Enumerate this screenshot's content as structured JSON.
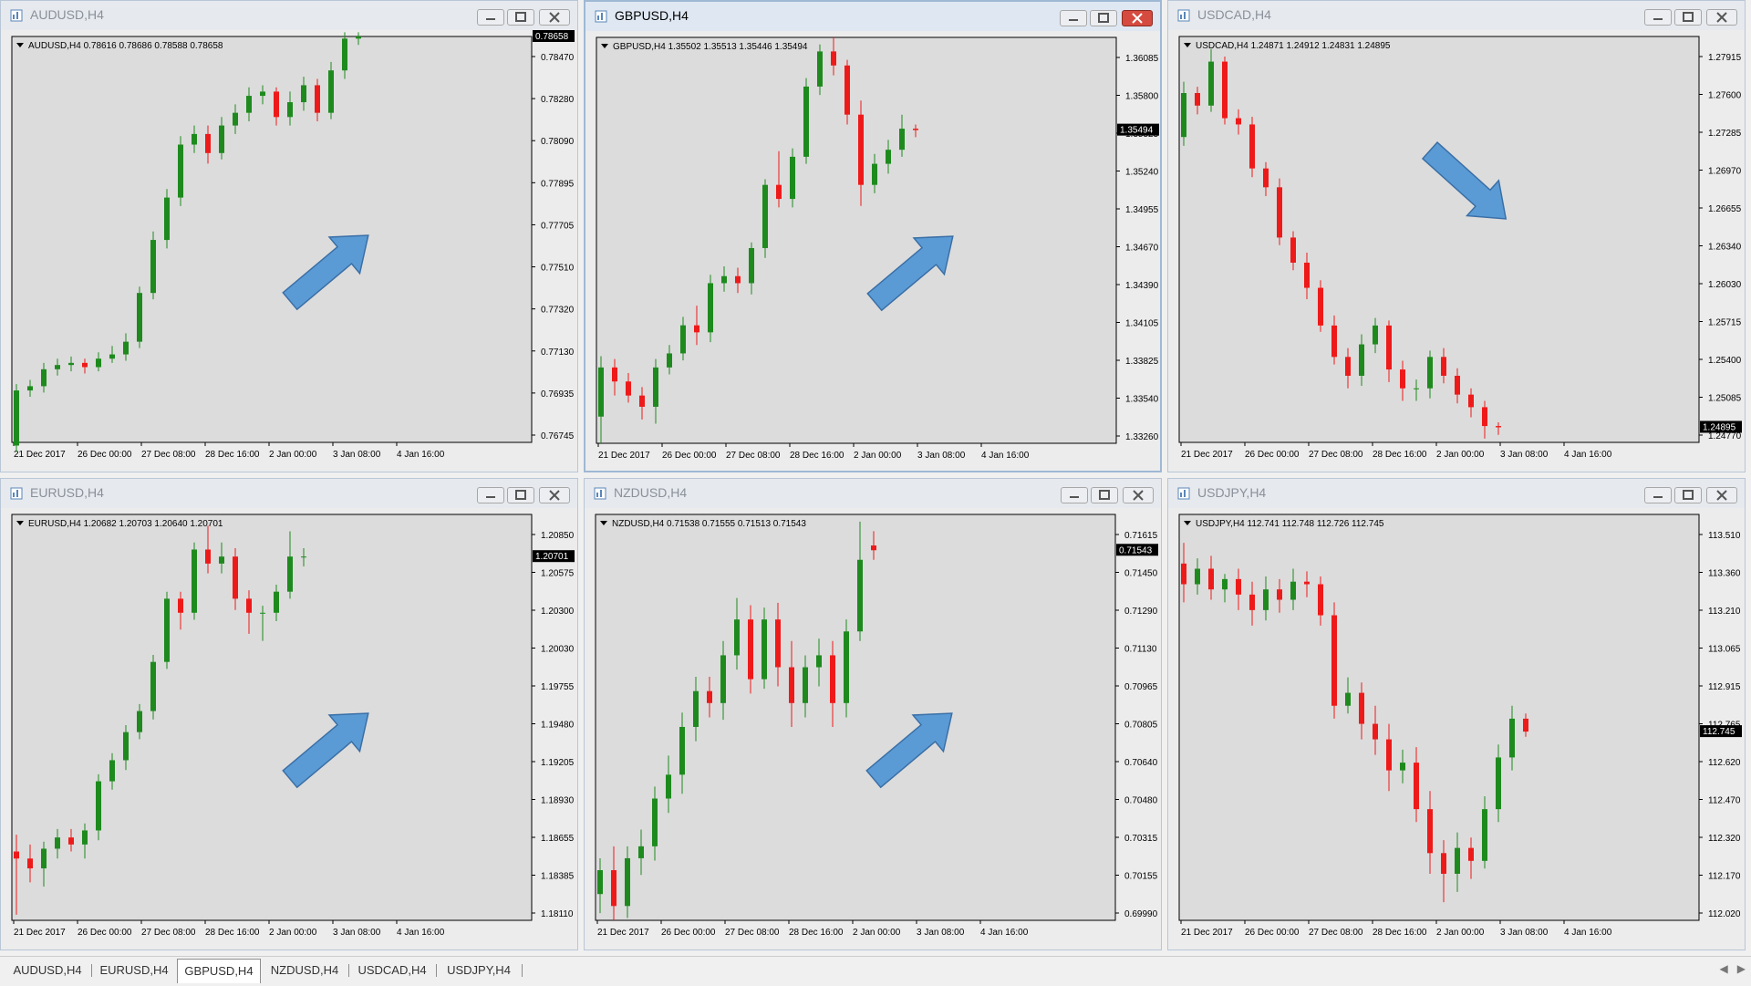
{
  "colors": {
    "bull": "#1e8a1e",
    "bear": "#ee1a1a",
    "wick": "#000000",
    "plot_bg": "#dcdcdc",
    "window_bg": "#ececec",
    "axis": "#000000",
    "arrow_fill": "#5b9bd5",
    "arrow_stroke": "#3a6fa6",
    "price_tag_bg": "#000000",
    "price_tag_fg": "#ffffff"
  },
  "x_tick_labels": [
    "21 Dec 2017",
    "26 Dec 00:00",
    "27 Dec 08:00",
    "28 Dec 16:00",
    "2 Jan 00:00",
    "3 Jan 08:00",
    "4 Jan 16:00"
  ],
  "windows": [
    {
      "title": "AUDUSD,H4",
      "active": false,
      "info": "AUDUSD,H4  0.78616 0.78686 0.78588 0.78658",
      "current_price": "0.78658",
      "y_ticks": [
        "0.78470",
        "0.78280",
        "0.78090",
        "0.77895",
        "0.77705",
        "0.77510",
        "0.77320",
        "0.77130",
        "0.76935",
        "0.76745"
      ],
      "arrow": "up",
      "chart_data": {
        "type": "candlestick",
        "ylim": [
          0.76745,
          0.7866
        ],
        "open": [
          0.7673,
          0.7699,
          0.7701,
          0.7709,
          0.7711,
          0.7712,
          0.771,
          0.7714,
          0.7716,
          0.7722,
          0.7745,
          0.777,
          0.779,
          0.7815,
          0.782,
          0.7811,
          0.7824,
          0.783,
          0.7838,
          0.784,
          0.7828,
          0.7835,
          0.7843,
          0.783,
          0.785,
          0.7865
        ],
        "close": [
          0.7699,
          0.7701,
          0.7709,
          0.7711,
          0.7712,
          0.771,
          0.7714,
          0.7716,
          0.7722,
          0.7745,
          0.777,
          0.779,
          0.7815,
          0.782,
          0.7811,
          0.7824,
          0.783,
          0.7838,
          0.784,
          0.7828,
          0.7835,
          0.7843,
          0.783,
          0.785,
          0.7865,
          0.7866
        ],
        "high": [
          0.7702,
          0.7704,
          0.7712,
          0.7714,
          0.7715,
          0.7714,
          0.7717,
          0.772,
          0.7726,
          0.7748,
          0.7774,
          0.7794,
          0.7819,
          0.7824,
          0.7824,
          0.7828,
          0.7834,
          0.7842,
          0.7843,
          0.7842,
          0.784,
          0.7847,
          0.7846,
          0.7854,
          0.7868,
          0.7868
        ],
        "low": [
          0.767,
          0.7696,
          0.7698,
          0.7706,
          0.7708,
          0.7707,
          0.7708,
          0.7712,
          0.7713,
          0.7719,
          0.7742,
          0.7766,
          0.7786,
          0.7811,
          0.7806,
          0.7808,
          0.782,
          0.7826,
          0.7834,
          0.7824,
          0.7824,
          0.7831,
          0.7826,
          0.7827,
          0.7846,
          0.7862
        ]
      }
    },
    {
      "title": "GBPUSD,H4",
      "active": true,
      "info": "GBPUSD,H4  1.35502 1.35513 1.35446 1.35494",
      "current_price": "1.35494",
      "y_ticks": [
        "1.36085",
        "1.35800",
        "1.35525",
        "1.35240",
        "1.34955",
        "1.34670",
        "1.34390",
        "1.34105",
        "1.33825",
        "1.33540",
        "1.33260"
      ],
      "arrow": "up",
      "chart_data": {
        "type": "candlestick",
        "ylim": [
          1.3326,
          1.3615
        ],
        "open": [
          1.3345,
          1.338,
          1.337,
          1.336,
          1.3352,
          1.338,
          1.339,
          1.341,
          1.3405,
          1.344,
          1.3445,
          1.344,
          1.3465,
          1.351,
          1.35,
          1.353,
          1.358,
          1.3605,
          1.3595,
          1.356,
          1.351,
          1.3525,
          1.3535,
          1.355
        ],
        "close": [
          1.338,
          1.337,
          1.336,
          1.3352,
          1.338,
          1.339,
          1.341,
          1.3405,
          1.344,
          1.3445,
          1.344,
          1.3465,
          1.351,
          1.35,
          1.353,
          1.358,
          1.3605,
          1.3595,
          1.356,
          1.351,
          1.3525,
          1.3535,
          1.355,
          1.3549
        ],
        "high": [
          1.3388,
          1.3386,
          1.3376,
          1.3366,
          1.3386,
          1.3396,
          1.3416,
          1.3424,
          1.3446,
          1.3452,
          1.3451,
          1.3469,
          1.3514,
          1.3534,
          1.3536,
          1.3586,
          1.361,
          1.3615,
          1.3599,
          1.357,
          1.3532,
          1.3542,
          1.356,
          1.3553
        ],
        "low": [
          1.3326,
          1.336,
          1.3355,
          1.3343,
          1.334,
          1.3375,
          1.3385,
          1.3396,
          1.3398,
          1.3434,
          1.3433,
          1.3432,
          1.3458,
          1.3494,
          1.3494,
          1.3525,
          1.3574,
          1.3588,
          1.3553,
          1.3495,
          1.3504,
          1.3518,
          1.353,
          1.3544
        ]
      }
    },
    {
      "title": "USDCAD,H4",
      "active": false,
      "info": "USDCAD,H4  1.24871 1.24912 1.24831 1.24895",
      "current_price": "1.24895",
      "y_ticks": [
        "1.27915",
        "1.27600",
        "1.27285",
        "1.26970",
        "1.26655",
        "1.26340",
        "1.26030",
        "1.25715",
        "1.25400",
        "1.25085",
        "1.24770"
      ],
      "arrow": "down",
      "chart_data": {
        "type": "candlestick",
        "ylim": [
          1.2477,
          1.28
        ],
        "open": [
          1.272,
          1.2755,
          1.2745,
          1.278,
          1.2735,
          1.273,
          1.2695,
          1.268,
          1.264,
          1.262,
          1.26,
          1.257,
          1.2545,
          1.253,
          1.2555,
          1.257,
          1.2535,
          1.252,
          1.252,
          1.2545,
          1.253,
          1.2515,
          1.2505,
          1.249
        ],
        "close": [
          1.2755,
          1.2745,
          1.278,
          1.2735,
          1.273,
          1.2695,
          1.268,
          1.264,
          1.262,
          1.26,
          1.257,
          1.2545,
          1.253,
          1.2555,
          1.257,
          1.2535,
          1.252,
          1.252,
          1.2545,
          1.253,
          1.2515,
          1.2505,
          1.249,
          1.2489
        ],
        "high": [
          1.2764,
          1.276,
          1.279,
          1.2784,
          1.2742,
          1.2736,
          1.27,
          1.2687,
          1.2645,
          1.2628,
          1.2606,
          1.2578,
          1.2552,
          1.2563,
          1.2576,
          1.2574,
          1.2542,
          1.2527,
          1.255,
          1.2552,
          1.2536,
          1.252,
          1.251,
          1.2493
        ],
        "low": [
          1.2713,
          1.2738,
          1.274,
          1.273,
          1.2722,
          1.2688,
          1.2673,
          1.2634,
          1.2614,
          1.2591,
          1.2565,
          1.2539,
          1.252,
          1.2522,
          1.2548,
          1.2525,
          1.251,
          1.251,
          1.2512,
          1.2524,
          1.2508,
          1.2497,
          1.248,
          1.2483
        ]
      }
    },
    {
      "title": "EURUSD,H4",
      "active": false,
      "info": "EURUSD,H4  1.20682 1.20703 1.20640 1.20701",
      "current_price": "1.20701",
      "y_ticks": [
        "1.20850",
        "1.20575",
        "1.20300",
        "1.20030",
        "1.19755",
        "1.19480",
        "1.19205",
        "1.18930",
        "1.18655",
        "1.18385",
        "1.18110"
      ],
      "arrow": "up",
      "chart_data": {
        "type": "candlestick",
        "ylim": [
          1.1811,
          1.21
        ],
        "open": [
          1.186,
          1.1855,
          1.1848,
          1.1862,
          1.187,
          1.1865,
          1.1875,
          1.191,
          1.1925,
          1.1945,
          1.196,
          1.1995,
          1.204,
          1.203,
          1.2075,
          1.2065,
          1.207,
          1.204,
          1.203,
          1.203,
          1.2045,
          1.207
        ],
        "close": [
          1.1855,
          1.1848,
          1.1862,
          1.187,
          1.1865,
          1.1875,
          1.191,
          1.1925,
          1.1945,
          1.196,
          1.1995,
          1.204,
          1.203,
          1.2075,
          1.2065,
          1.207,
          1.204,
          1.203,
          1.203,
          1.2045,
          1.207,
          1.207
        ],
        "high": [
          1.1872,
          1.1865,
          1.1867,
          1.1876,
          1.1876,
          1.188,
          1.1915,
          1.193,
          1.195,
          1.1965,
          1.2,
          1.2045,
          1.2045,
          1.208,
          1.2092,
          1.208,
          1.2076,
          1.2046,
          1.2035,
          1.205,
          1.2088,
          1.2076
        ],
        "low": [
          1.1815,
          1.1838,
          1.1835,
          1.1855,
          1.186,
          1.1855,
          1.1868,
          1.1904,
          1.1918,
          1.194,
          1.1954,
          1.199,
          1.2018,
          1.2025,
          1.2058,
          1.2058,
          1.2032,
          1.2015,
          1.201,
          1.2024,
          1.204,
          1.2063
        ]
      }
    },
    {
      "title": "NZDUSD,H4",
      "active": false,
      "info": "NZDUSD,H4  0.71538 0.71555 0.71513 0.71543",
      "current_price": "0.71543",
      "y_ticks": [
        "0.71615",
        "0.71450",
        "0.71290",
        "0.71130",
        "0.70965",
        "0.70805",
        "0.70640",
        "0.70480",
        "0.70315",
        "0.70155",
        "0.69990"
      ],
      "arrow": "up",
      "chart_data": {
        "type": "candlestick",
        "ylim": [
          0.6999,
          0.7169
        ],
        "open": [
          0.701,
          0.702,
          0.7005,
          0.7025,
          0.703,
          0.705,
          0.706,
          0.708,
          0.7095,
          0.709,
          0.711,
          0.7125,
          0.71,
          0.7125,
          0.7105,
          0.709,
          0.7105,
          0.711,
          0.709,
          0.712,
          0.7156
        ],
        "close": [
          0.702,
          0.7005,
          0.7025,
          0.703,
          0.705,
          0.706,
          0.708,
          0.7095,
          0.709,
          0.711,
          0.7125,
          0.71,
          0.7125,
          0.7105,
          0.709,
          0.7105,
          0.711,
          0.709,
          0.712,
          0.715,
          0.7154
        ],
        "high": [
          0.7025,
          0.703,
          0.703,
          0.7037,
          0.7055,
          0.7068,
          0.7086,
          0.7101,
          0.7101,
          0.7116,
          0.7134,
          0.7131,
          0.713,
          0.7132,
          0.7116,
          0.711,
          0.7117,
          0.7116,
          0.7125,
          0.7166,
          0.7162
        ],
        "low": [
          0.7002,
          0.6999,
          0.7,
          0.7018,
          0.7024,
          0.7044,
          0.7052,
          0.7074,
          0.7084,
          0.7083,
          0.7104,
          0.7094,
          0.7096,
          0.7097,
          0.708,
          0.7084,
          0.7097,
          0.708,
          0.7084,
          0.7116,
          0.715
        ]
      }
    },
    {
      "title": "USDJPY,H4",
      "active": false,
      "info": "USDJPY,H4  112.741 112.748 112.726 112.745",
      "current_price": "112.745",
      "y_ticks": [
        "113.510",
        "113.360",
        "113.210",
        "113.065",
        "112.915",
        "112.765",
        "112.620",
        "112.470",
        "112.320",
        "112.170",
        "112.020"
      ],
      "arrow": "none",
      "chart_data": {
        "type": "candlestick",
        "ylim": [
          112.02,
          113.59
        ],
        "open": [
          113.4,
          113.32,
          113.38,
          113.3,
          113.34,
          113.28,
          113.22,
          113.3,
          113.26,
          113.33,
          113.32,
          113.2,
          112.85,
          112.9,
          112.78,
          112.72,
          112.6,
          112.63,
          112.45,
          112.28,
          112.2,
          112.3,
          112.25,
          112.45,
          112.65,
          112.8
        ],
        "close": [
          113.32,
          113.38,
          113.3,
          113.34,
          113.28,
          113.22,
          113.3,
          113.26,
          113.33,
          113.32,
          113.2,
          112.85,
          112.9,
          112.78,
          112.72,
          112.6,
          112.63,
          112.45,
          112.28,
          112.2,
          112.3,
          112.25,
          112.45,
          112.65,
          112.8,
          112.75
        ],
        "high": [
          113.48,
          113.42,
          113.43,
          113.36,
          113.38,
          113.33,
          113.35,
          113.34,
          113.38,
          113.37,
          113.35,
          113.25,
          112.96,
          112.94,
          112.85,
          112.78,
          112.68,
          112.69,
          112.52,
          112.33,
          112.36,
          112.34,
          112.5,
          112.7,
          112.85,
          112.82
        ],
        "low": [
          113.25,
          113.28,
          113.26,
          113.25,
          113.22,
          113.16,
          113.18,
          113.21,
          113.22,
          113.27,
          113.16,
          112.8,
          112.82,
          112.72,
          112.66,
          112.52,
          112.55,
          112.4,
          112.2,
          112.09,
          112.13,
          112.18,
          112.22,
          112.4,
          112.6,
          112.73
        ]
      }
    }
  ],
  "tabs": [
    "AUDUSD,H4",
    "EURUSD,H4",
    "GBPUSD,H4",
    "NZDUSD,H4",
    "USDCAD,H4",
    "USDJPY,H4"
  ],
  "active_tab": "GBPUSD,H4"
}
